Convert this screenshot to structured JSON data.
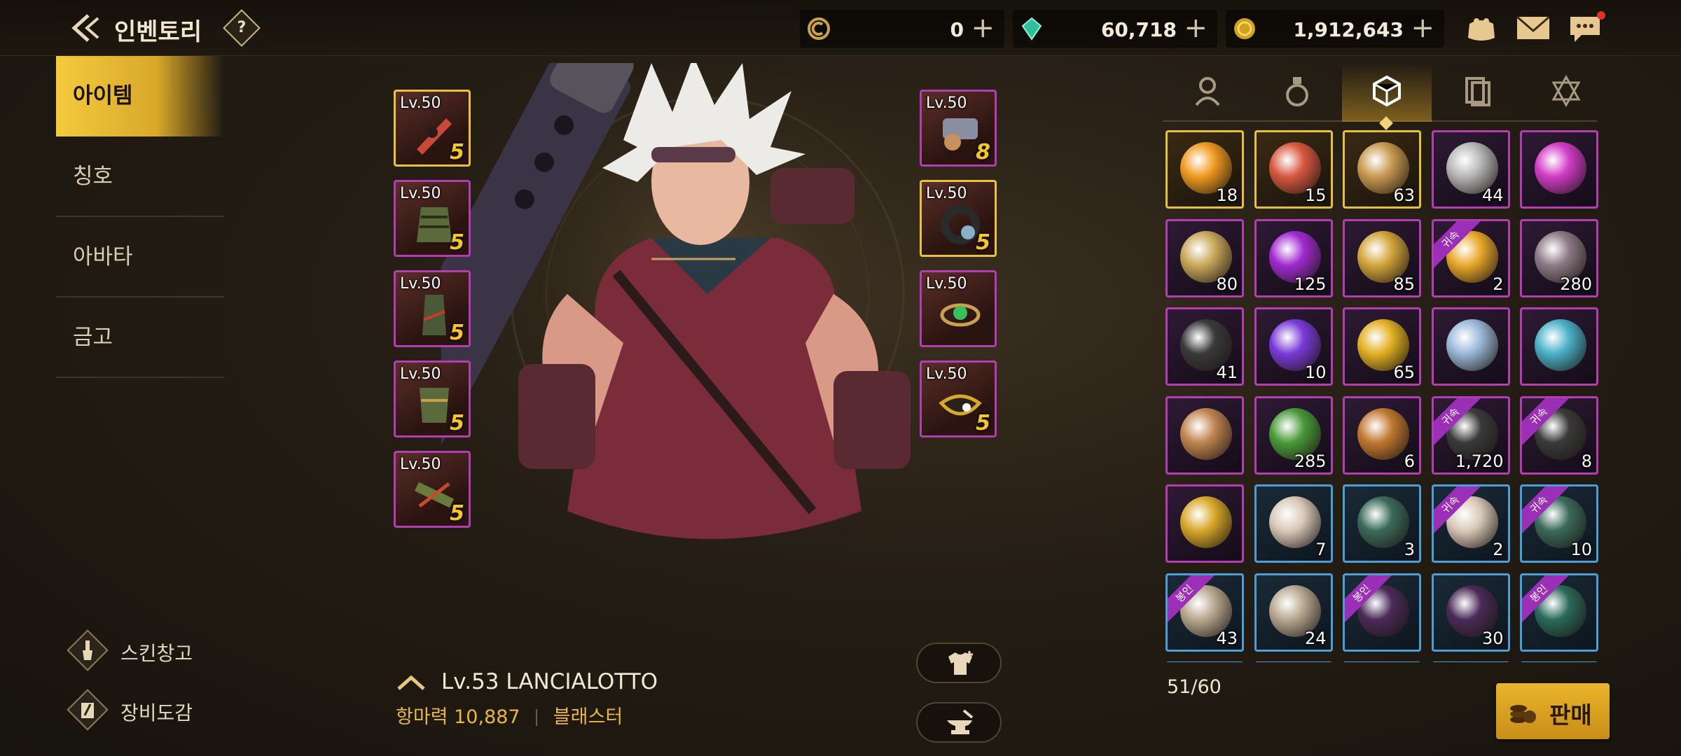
{
  "header": {
    "title": "인벤토리",
    "help_label": "?"
  },
  "currencies": [
    {
      "name": "c-coin",
      "value": "0",
      "color": "#c9a24a"
    },
    {
      "name": "gem",
      "value": "60,718",
      "color": "#2fbf9a"
    },
    {
      "name": "gold",
      "value": "1,912,643",
      "color": "#d4a020"
    }
  ],
  "top_icons": [
    "pouch-icon",
    "mail-icon",
    "chat-icon"
  ],
  "side_menu": {
    "items": [
      {
        "label": "아이템",
        "active": true
      },
      {
        "label": "칭호"
      },
      {
        "label": "아바타"
      },
      {
        "label": "금고"
      }
    ],
    "links": [
      {
        "label": "스킨창고",
        "icon": "brush-icon"
      },
      {
        "label": "장비도감",
        "icon": "pen-book-icon"
      }
    ]
  },
  "equipment": {
    "left": [
      {
        "level": "Lv.50",
        "enhance": "5",
        "rarity": "gold"
      },
      {
        "level": "Lv.50",
        "enhance": "5",
        "rarity": "purple"
      },
      {
        "level": "Lv.50",
        "enhance": "5",
        "rarity": "purple"
      },
      {
        "level": "Lv.50",
        "enhance": "5",
        "rarity": "purple"
      },
      {
        "level": "Lv.50",
        "enhance": "5",
        "rarity": "purple"
      }
    ],
    "right": [
      {
        "level": "Lv.50",
        "enhance": "8",
        "rarity": "purple"
      },
      {
        "level": "Lv.50",
        "enhance": "5",
        "rarity": "gold"
      },
      {
        "level": "Lv.50",
        "enhance": "",
        "rarity": "purple"
      },
      {
        "level": "Lv.50",
        "enhance": "5",
        "rarity": "purple"
      }
    ]
  },
  "character": {
    "name": "Lv.53 LANCIALOTTO",
    "power_label": "항마력",
    "power_value": "10,887",
    "class": "블래스터"
  },
  "inventory_tabs": [
    "armor-tab-icon",
    "potion-tab-icon",
    "materials-tab-icon",
    "cards-tab-icon",
    "emblem-tab-icon"
  ],
  "inventory_tab_active": 2,
  "slots_count": "51/60",
  "sell_label": "판매",
  "items": [
    {
      "count": "18",
      "rarity": "gold",
      "color": "#f09a20"
    },
    {
      "count": "15",
      "rarity": "gold",
      "color": "#d85840"
    },
    {
      "count": "63",
      "rarity": "gold",
      "color": "#c89a52"
    },
    {
      "count": "44",
      "rarity": "purple",
      "color": "#b7b7b7"
    },
    {
      "count": "",
      "rarity": "purple",
      "color": "#d23cc8"
    },
    {
      "count": "80",
      "rarity": "purple",
      "color": "#c8a85a"
    },
    {
      "count": "125",
      "rarity": "purple",
      "color": "#a02ad0"
    },
    {
      "count": "85",
      "rarity": "purple",
      "color": "#d2a43a"
    },
    {
      "count": "2",
      "rarity": "purple",
      "color": "#e8a82a",
      "badge": "귀속"
    },
    {
      "count": "280",
      "rarity": "purple",
      "color": "#8c7a86"
    },
    {
      "count": "41",
      "rarity": "purple",
      "color": "#3a3a3a"
    },
    {
      "count": "10",
      "rarity": "purple",
      "color": "#7a3ad8"
    },
    {
      "count": "65",
      "rarity": "purple",
      "color": "#e2b022"
    },
    {
      "count": "",
      "rarity": "purple",
      "color": "#9ab8d8"
    },
    {
      "count": "",
      "rarity": "purple",
      "color": "#4ab0c8"
    },
    {
      "count": "",
      "rarity": "purple",
      "color": "#c08450"
    },
    {
      "count": "285",
      "rarity": "purple",
      "color": "#4a9a3a"
    },
    {
      "count": "6",
      "rarity": "purple",
      "color": "#c07830"
    },
    {
      "count": "1,720",
      "rarity": "purple",
      "color": "#3a3a3a",
      "badge": "귀속"
    },
    {
      "count": "8",
      "rarity": "purple",
      "color": "#3a3a3a",
      "badge": "귀속"
    },
    {
      "count": "",
      "rarity": "purple",
      "color": "#d8a82a"
    },
    {
      "count": "7",
      "rarity": "blue",
      "color": "#d8c8b8"
    },
    {
      "count": "3",
      "rarity": "blue",
      "color": "#3a6a5a"
    },
    {
      "count": "2",
      "rarity": "blue",
      "color": "#d8c8b8",
      "badge": "귀속"
    },
    {
      "count": "10",
      "rarity": "blue",
      "color": "#3a6a5a",
      "badge": "귀속"
    },
    {
      "count": "43",
      "rarity": "blue",
      "color": "#b8a890",
      "badge": "봉인"
    },
    {
      "count": "24",
      "rarity": "blue",
      "color": "#b8a890"
    },
    {
      "count": "",
      "rarity": "blue",
      "color": "#4a2a58",
      "badge": "봉인"
    },
    {
      "count": "30",
      "rarity": "blue",
      "color": "#4a2a58"
    },
    {
      "count": "",
      "rarity": "blue",
      "color": "#2a6a5a",
      "badge": "봉인"
    }
  ]
}
